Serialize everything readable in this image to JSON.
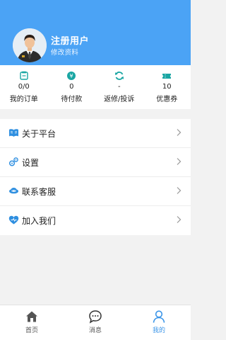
{
  "header": {
    "user_name": "注册用户",
    "edit_profile": "修改资料",
    "background_color": "#4ba3f5"
  },
  "stats": [
    {
      "value": "0/0",
      "label": "我的订单",
      "icon": "order-icon"
    },
    {
      "value": "0",
      "label": "待付款",
      "icon": "payment-icon"
    },
    {
      "value": "-",
      "label": "返修/投诉",
      "icon": "repair-icon"
    },
    {
      "value": "10",
      "label": "优惠券",
      "icon": "coupon-icon"
    }
  ],
  "menu": [
    {
      "label": "关于平台",
      "icon": "book-icon"
    },
    {
      "label": "设置",
      "icon": "settings-icon"
    },
    {
      "label": "联系客服",
      "icon": "customer-service-icon"
    },
    {
      "label": "加入我们",
      "icon": "heart-icon"
    }
  ],
  "tabbar": [
    {
      "label": "首页",
      "icon": "home-icon"
    },
    {
      "label": "消息",
      "icon": "message-icon"
    },
    {
      "label": "我的",
      "icon": "profile-icon",
      "active": true
    }
  ],
  "accent_color": "#3b95e8"
}
